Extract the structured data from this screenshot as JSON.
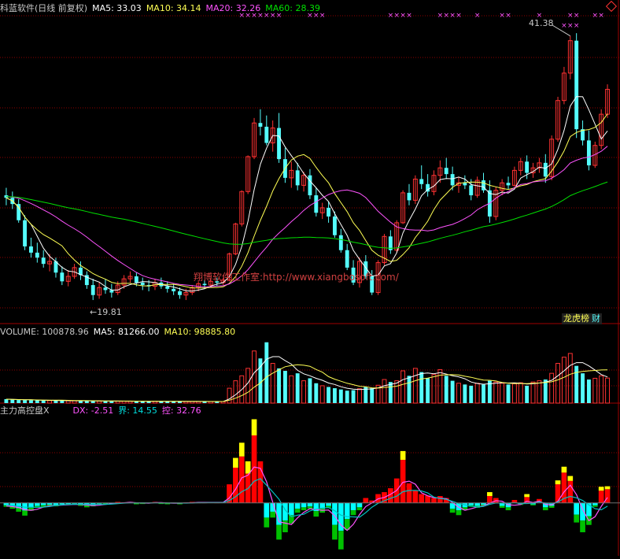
{
  "header_main": {
    "title": "科蓝软件(日线 前复权)",
    "ma5": "MA5: 33.03",
    "ma10": "MA10: 34.14",
    "ma20": "MA20: 32.26",
    "ma60": "MA60: 28.39"
  },
  "header_volume": {
    "label": "VOLUME: 100878.96",
    "ma5": "MA5: 81266.00",
    "ma10": "MA10: 98885.80"
  },
  "header_indicator": {
    "name": "主力高控盘X",
    "dx": "DX: -2.51",
    "jie": "界: 14.55",
    "kong": "控: 32.76"
  },
  "annotations": {
    "high": "41.38",
    "low": "19.81",
    "watermark": "翔博软件工作室:http://www.xiangbosoft.com/",
    "marker": "×"
  },
  "buttons": {
    "rank": "龙虎榜",
    "fin": "财"
  },
  "colors": {
    "up": "#ff3232",
    "down": "#54fcfc",
    "ma5": "#ffffff",
    "ma10": "#ffff54",
    "ma20": "#ff54ff",
    "ma60": "#00e000",
    "grid": "#8b0000",
    "ind_red": "#ff0000",
    "ind_yellow": "#ffff00",
    "ind_cyan": "#00ffff",
    "ind_green": "#00c000"
  },
  "chart_data": {
    "type": "candlestick",
    "price_range": [
      18.5,
      43.0
    ],
    "candles": [
      [
        28.6,
        29.2,
        27.8,
        28.4
      ],
      [
        28.4,
        28.9,
        27.5,
        27.9
      ],
      [
        27.9,
        28.3,
        26.4,
        26.6
      ],
      [
        26.6,
        27.0,
        24.2,
        24.5
      ],
      [
        24.5,
        25.2,
        23.6,
        24.0
      ],
      [
        24.0,
        24.8,
        23.2,
        23.6
      ],
      [
        23.6,
        24.2,
        22.8,
        23.1
      ],
      [
        23.1,
        23.9,
        22.5,
        23.3
      ],
      [
        23.3,
        23.6,
        22.0,
        22.4
      ],
      [
        22.4,
        22.9,
        21.4,
        21.7
      ],
      [
        21.7,
        22.6,
        21.3,
        22.1
      ],
      [
        22.1,
        23.1,
        21.9,
        22.8
      ],
      [
        22.8,
        23.3,
        21.8,
        22.2
      ],
      [
        22.2,
        22.5,
        21.1,
        21.4
      ],
      [
        21.4,
        21.9,
        20.2,
        20.6
      ],
      [
        20.6,
        21.6,
        20.3,
        21.2
      ],
      [
        21.2,
        21.9,
        20.7,
        21.0
      ],
      [
        21.0,
        21.5,
        20.4,
        20.8
      ],
      [
        20.8,
        21.7,
        20.6,
        21.4
      ],
      [
        21.4,
        22.2,
        21.1,
        21.9
      ],
      [
        21.9,
        22.5,
        21.6,
        22.1
      ],
      [
        22.1,
        22.4,
        21.3,
        21.6
      ],
      [
        21.6,
        22.0,
        21.0,
        21.4
      ],
      [
        21.4,
        21.8,
        20.9,
        21.3
      ],
      [
        21.3,
        21.9,
        21.0,
        21.6
      ],
      [
        21.6,
        22.0,
        21.1,
        21.3
      ],
      [
        21.3,
        21.7,
        20.8,
        21.1
      ],
      [
        21.1,
        21.5,
        20.6,
        20.9
      ],
      [
        20.9,
        21.2,
        20.3,
        20.6
      ],
      [
        20.6,
        21.1,
        20.2,
        20.8
      ],
      [
        20.8,
        21.4,
        20.6,
        21.2
      ],
      [
        21.2,
        21.7,
        20.9,
        21.5
      ],
      [
        21.5,
        21.8,
        21.1,
        21.4
      ],
      [
        21.4,
        21.9,
        21.2,
        21.7
      ],
      [
        21.7,
        22.0,
        21.3,
        21.6
      ],
      [
        21.6,
        22.0,
        21.4,
        21.8
      ],
      [
        21.8,
        24.0,
        21.7,
        23.9
      ],
      [
        23.9,
        26.4,
        23.8,
        26.3
      ],
      [
        26.3,
        29.0,
        26.1,
        28.9
      ],
      [
        28.9,
        31.8,
        28.7,
        31.7
      ],
      [
        31.7,
        34.8,
        31.5,
        34.4
      ],
      [
        34.4,
        35.5,
        33.4,
        34.1
      ],
      [
        34.1,
        35.0,
        32.6,
        32.8
      ],
      [
        32.8,
        34.6,
        32.1,
        34.0
      ],
      [
        34.0,
        35.2,
        31.2,
        31.5
      ],
      [
        31.5,
        32.4,
        29.6,
        30.0
      ],
      [
        30.0,
        31.3,
        29.2,
        30.6
      ],
      [
        30.6,
        31.2,
        29.0,
        29.4
      ],
      [
        29.4,
        30.5,
        28.9,
        30.2
      ],
      [
        30.2,
        30.7,
        28.3,
        28.6
      ],
      [
        28.6,
        29.2,
        26.9,
        27.2
      ],
      [
        27.2,
        28.0,
        26.7,
        27.6
      ],
      [
        27.6,
        28.1,
        26.4,
        26.9
      ],
      [
        26.9,
        27.3,
        25.2,
        25.4
      ],
      [
        25.4,
        25.9,
        24.0,
        24.2
      ],
      [
        24.2,
        24.7,
        22.6,
        22.8
      ],
      [
        22.8,
        23.4,
        21.4,
        21.6
      ],
      [
        21.6,
        23.6,
        21.2,
        23.3
      ],
      [
        23.3,
        23.8,
        21.9,
        22.1
      ],
      [
        22.1,
        22.6,
        20.6,
        20.8
      ],
      [
        20.8,
        23.4,
        20.6,
        23.2
      ],
      [
        23.2,
        25.5,
        23.0,
        25.3
      ],
      [
        25.3,
        25.8,
        23.9,
        24.2
      ],
      [
        24.2,
        26.6,
        24.0,
        26.4
      ],
      [
        26.4,
        29.0,
        26.3,
        28.8
      ],
      [
        28.8,
        29.5,
        27.8,
        28.2
      ],
      [
        28.2,
        30.2,
        27.9,
        29.9
      ],
      [
        29.9,
        31.0,
        29.1,
        29.5
      ],
      [
        29.5,
        30.3,
        28.5,
        28.9
      ],
      [
        28.9,
        30.6,
        28.6,
        30.2
      ],
      [
        30.2,
        31.4,
        29.6,
        30.8
      ],
      [
        30.8,
        31.6,
        29.9,
        30.3
      ],
      [
        30.3,
        30.9,
        29.0,
        29.4
      ],
      [
        29.4,
        30.1,
        28.8,
        29.6
      ],
      [
        29.6,
        30.2,
        29.1,
        29.4
      ],
      [
        29.4,
        29.9,
        28.2,
        28.6
      ],
      [
        28.6,
        30.1,
        28.4,
        29.8
      ],
      [
        29.8,
        30.4,
        28.8,
        29.0
      ],
      [
        29.0,
        29.8,
        26.4,
        26.9
      ],
      [
        26.9,
        29.3,
        26.6,
        29.0
      ],
      [
        29.0,
        29.9,
        28.6,
        29.6
      ],
      [
        29.6,
        30.1,
        29.1,
        29.4
      ],
      [
        29.4,
        30.9,
        29.3,
        30.6
      ],
      [
        30.6,
        31.6,
        30.2,
        31.3
      ],
      [
        31.3,
        31.8,
        29.9,
        30.4
      ],
      [
        30.4,
        31.2,
        30.0,
        30.8
      ],
      [
        30.8,
        31.6,
        30.4,
        31.2
      ],
      [
        31.2,
        31.9,
        29.6,
        30.1
      ],
      [
        30.1,
        33.4,
        29.8,
        33.1
      ],
      [
        33.1,
        36.5,
        32.9,
        36.2
      ],
      [
        36.2,
        38.9,
        35.9,
        38.4
      ],
      [
        38.4,
        41.38,
        37.9,
        41.0
      ],
      [
        41.0,
        41.6,
        33.2,
        33.9
      ],
      [
        33.9,
        34.6,
        32.6,
        33.0
      ],
      [
        33.0,
        33.8,
        30.6,
        31.0
      ],
      [
        31.0,
        32.9,
        30.8,
        32.6
      ],
      [
        32.6,
        35.5,
        32.3,
        35.1
      ],
      [
        35.1,
        37.5,
        34.8,
        37.1
      ]
    ],
    "volume_range": [
      0,
      260000
    ],
    "volume": [
      16000,
      14000,
      12500,
      12000,
      11500,
      11000,
      10500,
      10000,
      9800,
      9500,
      9300,
      9000,
      8800,
      8600,
      8400,
      8200,
      8000,
      7800,
      7700,
      7600,
      7500,
      7400,
      7300,
      7200,
      7100,
      7000,
      6900,
      6800,
      6700,
      6600,
      6500,
      6400,
      6300,
      6200,
      6100,
      6000,
      60000,
      90000,
      110000,
      140000,
      210000,
      180000,
      245000,
      160000,
      140000,
      130000,
      110000,
      120000,
      90000,
      100000,
      80000,
      70000,
      65000,
      60000,
      55000,
      50000,
      52000,
      58000,
      65000,
      60000,
      72000,
      95000,
      85000,
      90000,
      130000,
      110000,
      140000,
      125000,
      100000,
      115000,
      135000,
      110000,
      90000,
      80000,
      75000,
      70000,
      80000,
      75000,
      90000,
      85000,
      80000,
      75000,
      78000,
      82000,
      70000,
      85000,
      90000,
      95000,
      120000,
      160000,
      185000,
      200000,
      150000,
      120000,
      95000,
      100000,
      110000,
      100878.96
    ],
    "indicator_range": [
      -105,
      175
    ],
    "indicator": [
      [
        -8,
        0
      ],
      [
        -12,
        0
      ],
      [
        -18,
        0
      ],
      [
        -26,
        0
      ],
      [
        -16,
        0
      ],
      [
        -10,
        0
      ],
      [
        -8,
        0
      ],
      [
        -6,
        0
      ],
      [
        -7,
        0
      ],
      [
        -5,
        0
      ],
      [
        -4,
        0
      ],
      [
        -3,
        0
      ],
      [
        -6,
        0
      ],
      [
        -9,
        0
      ],
      [
        -7,
        0
      ],
      [
        -3,
        0
      ],
      [
        -2,
        0
      ],
      [
        -2,
        0
      ],
      [
        2,
        0
      ],
      [
        1,
        0
      ],
      [
        2,
        0
      ],
      [
        -2,
        0
      ],
      [
        -1,
        0
      ],
      [
        1,
        0
      ],
      [
        2,
        0
      ],
      [
        -1,
        0
      ],
      [
        -2,
        0
      ],
      [
        1,
        0
      ],
      [
        -2,
        0
      ],
      [
        1,
        0
      ],
      [
        2,
        0
      ],
      [
        1,
        0
      ],
      [
        1,
        0
      ],
      [
        2,
        0
      ],
      [
        1,
        0
      ],
      [
        2,
        0
      ],
      [
        38,
        0
      ],
      [
        72,
        20
      ],
      [
        95,
        28
      ],
      [
        60,
        25
      ],
      [
        138,
        33
      ],
      [
        85,
        0
      ],
      [
        -50,
        0
      ],
      [
        -30,
        0
      ],
      [
        -75,
        0
      ],
      [
        -60,
        0
      ],
      [
        -42,
        0
      ],
      [
        -20,
        0
      ],
      [
        -15,
        0
      ],
      [
        -12,
        0
      ],
      [
        -28,
        0
      ],
      [
        -20,
        0
      ],
      [
        -10,
        0
      ],
      [
        -75,
        0
      ],
      [
        -95,
        0
      ],
      [
        -55,
        0
      ],
      [
        -25,
        0
      ],
      [
        -15,
        0
      ],
      [
        10,
        0
      ],
      [
        5,
        0
      ],
      [
        18,
        0
      ],
      [
        22,
        0
      ],
      [
        30,
        0
      ],
      [
        50,
        0
      ],
      [
        88,
        18
      ],
      [
        40,
        0
      ],
      [
        25,
        0
      ],
      [
        18,
        0
      ],
      [
        15,
        0
      ],
      [
        10,
        0
      ],
      [
        14,
        0
      ],
      [
        10,
        0
      ],
      [
        -20,
        0
      ],
      [
        -25,
        0
      ],
      [
        -15,
        0
      ],
      [
        -8,
        0
      ],
      [
        -10,
        0
      ],
      [
        -6,
        0
      ],
      [
        14,
        8
      ],
      [
        10,
        0
      ],
      [
        -10,
        0
      ],
      [
        -15,
        0
      ],
      [
        6,
        0
      ],
      [
        -4,
        0
      ],
      [
        12,
        6
      ],
      [
        -5,
        0
      ],
      [
        8,
        0
      ],
      [
        -15,
        0
      ],
      [
        -10,
        0
      ],
      [
        38,
        8
      ],
      [
        62,
        12
      ],
      [
        45,
        10
      ],
      [
        -40,
        0
      ],
      [
        -60,
        0
      ],
      [
        -45,
        0
      ],
      [
        -8,
        0
      ],
      [
        25,
        8
      ],
      [
        28,
        6
      ]
    ]
  }
}
